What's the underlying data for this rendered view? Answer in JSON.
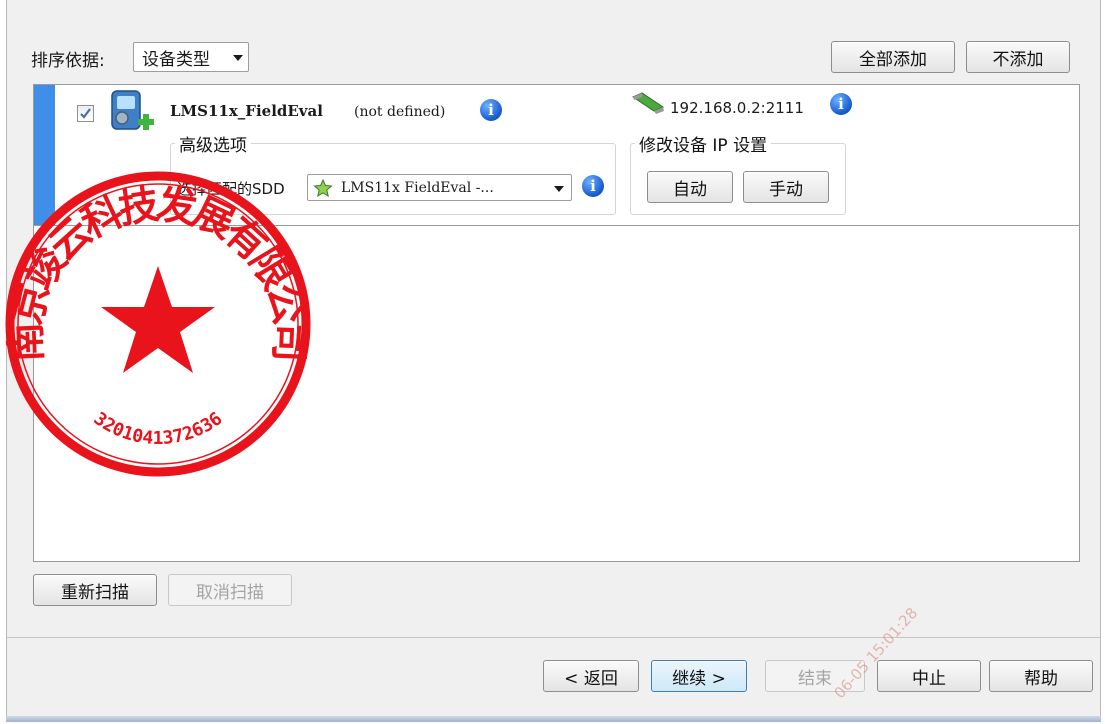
{
  "toolbar": {
    "sort_label": "排序依据:",
    "sort_value": "设备类型",
    "add_all_label": "全部添加",
    "add_none_label": "不添加"
  },
  "device": {
    "name": "LMS11x_FieldEval",
    "status": "(not defined)",
    "ip": "192.168.0.2:2111",
    "checked": true
  },
  "advanced": {
    "title": "高级选项",
    "sdd_label": "选择匹配的SDD",
    "sdd_value": "LMS11x FieldEval -..."
  },
  "ip_settings": {
    "title": "修改设备 IP 设置",
    "auto_label": "自动",
    "manual_label": "手动"
  },
  "scan": {
    "rescan_label": "重新扫描",
    "cancel_scan_label": "取消扫描"
  },
  "footer": {
    "back_label": "< 返回",
    "next_label": "继续 >",
    "finish_label": "结束",
    "abort_label": "中止",
    "help_label": "帮助"
  },
  "stamp": {
    "company": "南京竣云科技发展有限公司",
    "number": "3201041372636"
  },
  "watermark": "06-05 15:01:28",
  "colors": {
    "accent_bar": "#3f8ee8",
    "stamp_red": "#e8131b",
    "info_blue": "#1a5fd0"
  }
}
